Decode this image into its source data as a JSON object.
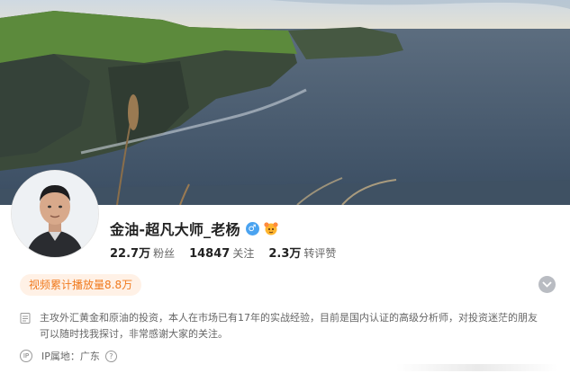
{
  "profile": {
    "name": "金油-超凡大师_老杨",
    "gender_symbol": "♂"
  },
  "stats": [
    {
      "value": "22.7万",
      "label": "粉丝"
    },
    {
      "value": "14847",
      "label": "关注"
    },
    {
      "value": "2.3万",
      "label": "转评赞"
    }
  ],
  "video_tag": "视频累计播放量8.8万",
  "description": "主攻外汇黄金和原油的投资，本人在市场已有17年的实战经验，目前是国内认证的高级分析师，对投资迷茫的朋友可以随时找我探讨，非常感谢大家的关注。",
  "ip": {
    "text": "IP属地：广东",
    "help_symbol": "?",
    "icon_text": "IP"
  },
  "icons": {
    "expand": "chevron-down-icon",
    "description": "document-icon",
    "location": "ip-location-icon",
    "help": "question-circle-icon",
    "badge": "super-fan-badge-icon"
  },
  "colors": {
    "tag_text": "#f07a1e",
    "tag_bg": "#fff1e6",
    "gender": "#4aa3f0"
  }
}
